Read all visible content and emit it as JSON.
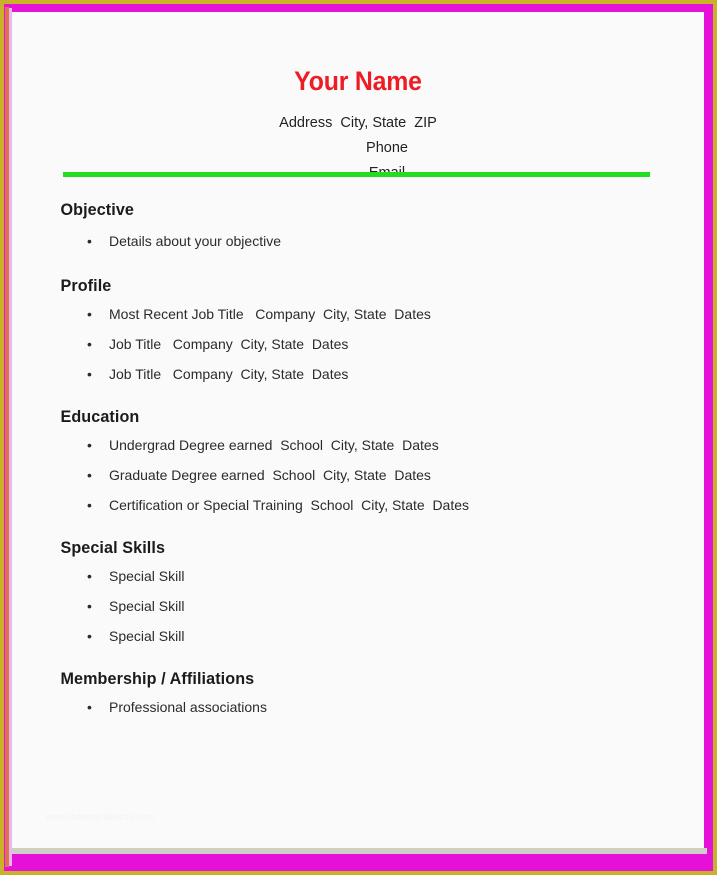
{
  "document": {
    "type": "resume-template",
    "name": "Your Name",
    "contact": {
      "address_line": "Address  City, State  ZIP",
      "phone_line": "Phone",
      "email_line": "Email"
    },
    "divider_color": "#22dd22",
    "name_color": "#ee1c25",
    "frame": {
      "outer_color": "#c9b229",
      "magenta_color": "#e611d9",
      "salmon_color": "#e0734f",
      "violet_color": "#eab8ee",
      "page_color": "#fbfafb"
    },
    "sections": [
      {
        "id": "objective",
        "heading": "Objective",
        "items": [
          "Details about your objective"
        ]
      },
      {
        "id": "profile",
        "heading": "Profile",
        "items": [
          "Most Recent Job Title   Company  City, State  Dates",
          "Job Title   Company  City, State  Dates",
          "Job Title   Company  City, State  Dates"
        ]
      },
      {
        "id": "education",
        "heading": "Education",
        "items": [
          "Undergrad Degree earned  School  City, State  Dates",
          "Graduate Degree earned  School  City, State  Dates",
          "Certification or Special Training  School  City, State  Dates"
        ]
      },
      {
        "id": "skills",
        "heading": "Special Skills",
        "items": [
          "Special Skill",
          "Special Skill",
          "Special Skill"
        ]
      },
      {
        "id": "membership",
        "heading": "Membership / Affiliations",
        "items": [
          "Professional associations"
        ]
      }
    ],
    "watermark": "www.thetemplatesite.com"
  }
}
